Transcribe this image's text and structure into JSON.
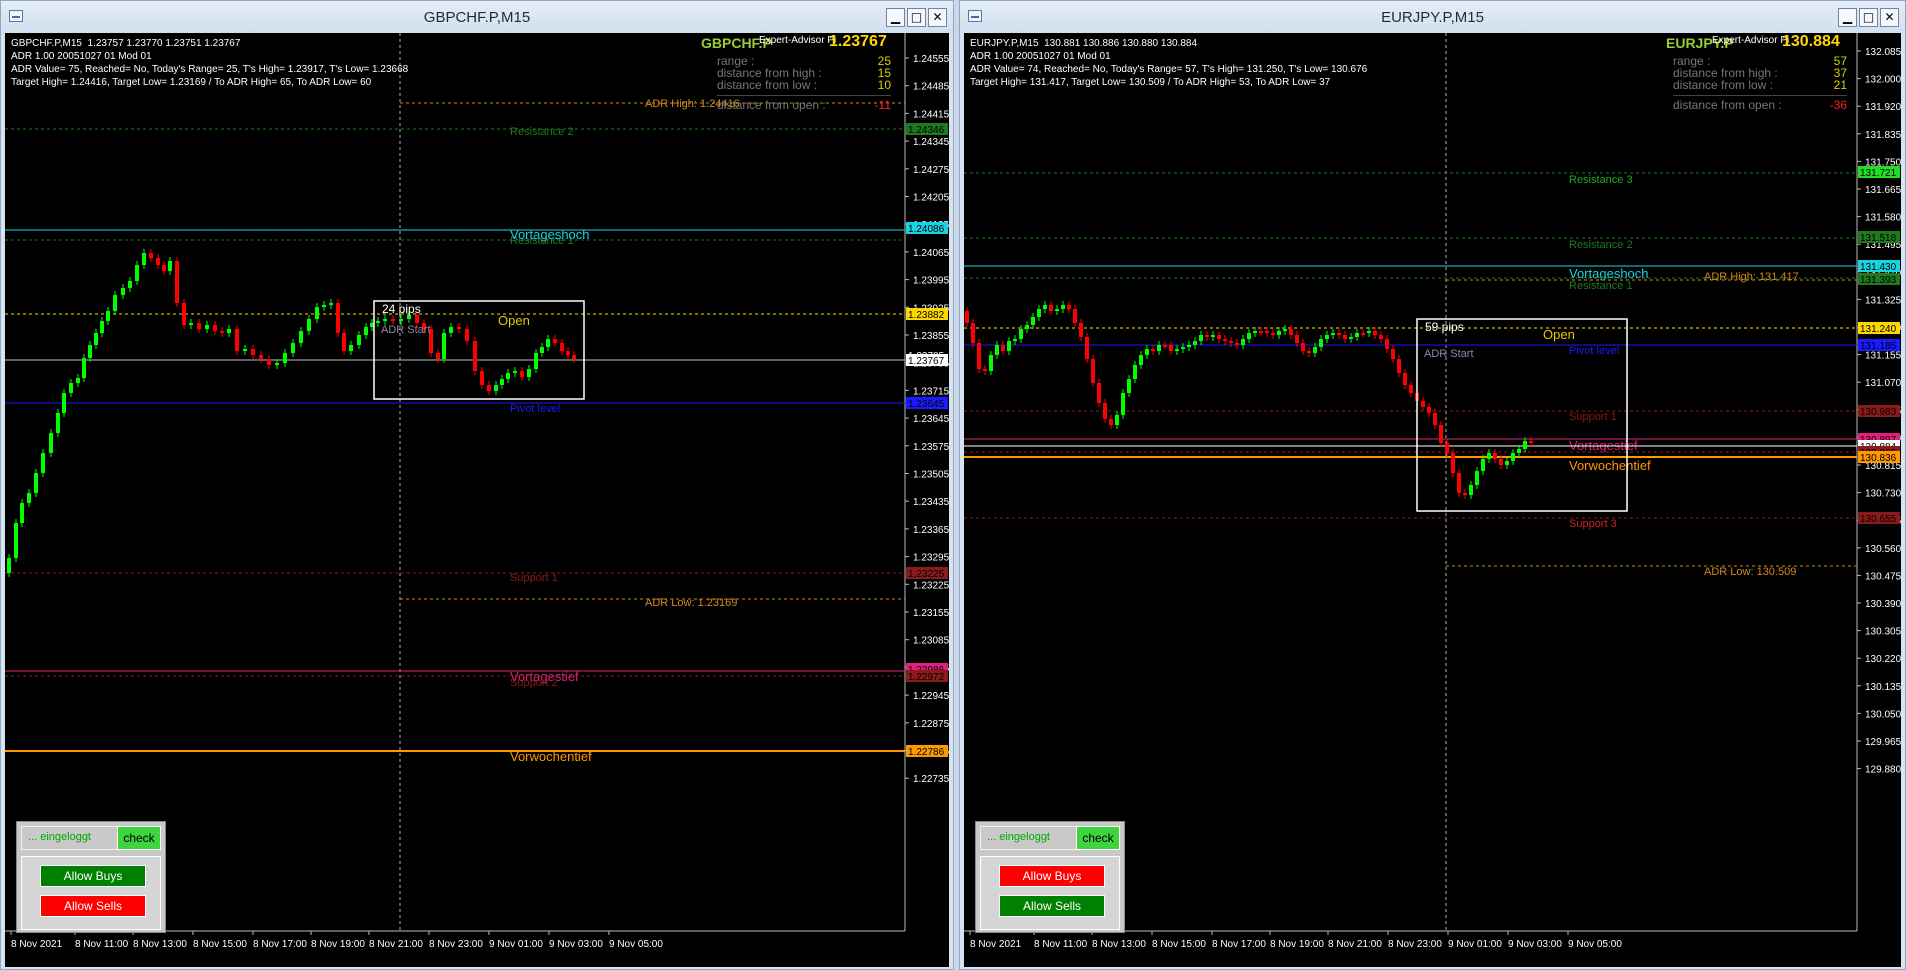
{
  "windows": [
    {
      "title": "GBPCHF.P,M15",
      "info_line1": "GBPCHF.P,M15  1.23757 1.23770 1.23751 1.23767",
      "info_line2": "ADR 1.00 20051027 01 Mod 01",
      "info_line3": "ADR Value= 75, Reached= No, Today's Range= 25, T's High= 1.23917, T's Low= 1.23668",
      "info_line4": "Target High= 1.24416, Target Low= 1.23169 / To ADR High= 65, To ADR Low= 60",
      "symbol_label": "GBPCHF.P",
      "ea_label": "Expert-Advisor Pi",
      "big_price": "1.23767",
      "stats": {
        "range_label": "range :",
        "range": "25",
        "dist_high_label": "distance from high :",
        "dist_high": "15",
        "dist_low_label": "distance from low :",
        "dist_low": "10",
        "dist_open_label": "distance from open :",
        "dist_open": "-11"
      },
      "price_ticks": [
        "1.24555",
        "1.24485",
        "1.24415",
        "1.24345",
        "1.24275",
        "1.24205",
        "1.24135",
        "1.24065",
        "1.23995",
        "1.23925",
        "1.23855",
        "1.23785",
        "1.23715",
        "1.23645",
        "1.23575",
        "1.23505",
        "1.23435",
        "1.23365",
        "1.23295",
        "1.23225",
        "1.23155",
        "1.23085",
        "1.23015",
        "1.22945",
        "1.22875",
        "1.22805",
        "1.22735"
      ],
      "price_flags": [
        "1.24346",
        "1.24086",
        "1.23882",
        "1.23785",
        "1.23767",
        "1.23645",
        "1.23225",
        "1.22986",
        "1.22972",
        "1.22786"
      ],
      "time_labels": [
        "8 Nov 2021",
        "8 Nov 11:00",
        "8 Nov 13:00",
        "8 Nov 15:00",
        "8 Nov 17:00",
        "8 Nov 19:00",
        "8 Nov 21:00",
        "8 Nov 23:00",
        "9 Nov 01:00",
        "9 Nov 03:00",
        "9 Nov 05:00"
      ],
      "levels": {
        "adr_high": "ADR High: 1.24416",
        "resistance2": "Resistance 2",
        "vortageshoch": "Vortageshoch",
        "resistance1": "Resistance 1",
        "pivot": "Pivot level",
        "support1": "Support 1",
        "adr_low": "ADR Low: 1.23169",
        "vortagestief": "Vortagestief",
        "support2": "Support 2",
        "vorwochentief": "Vorwochentief"
      },
      "box": {
        "pips": "24 pips",
        "adr_start": "ADR Start",
        "open": "Open"
      },
      "panel": {
        "status": "... eingeloggt",
        "check": "check",
        "buy": "Allow Buys",
        "sell": "Allow Sells",
        "buy_color": "#008000",
        "sell_color": "#ff0000"
      }
    },
    {
      "title": "EURJPY.P,M15",
      "info_line1": "EURJPY.P,M15  130.881 130.886 130.880 130.884",
      "info_line2": "ADR 1.00 20051027 01 Mod 01",
      "info_line3": "ADR Value= 74, Reached= No, Today's Range= 57, T's High= 131.250, T's Low= 130.676",
      "info_line4": "Target High= 131.417, Target Low= 130.509 / To ADR High= 53, To ADR Low= 37",
      "symbol_label": "EURJPY.P",
      "ea_label": "Expert-Advisor Pi",
      "big_price": "130.884",
      "stats": {
        "range_label": "range :",
        "range": "57",
        "dist_high_label": "distance from high :",
        "dist_high": "37",
        "dist_low_label": "distance from low :",
        "dist_low": "21",
        "dist_open_label": "distance from open :",
        "dist_open": "-36"
      },
      "price_ticks": [
        "132.085",
        "132.000",
        "131.920",
        "131.835",
        "131.750",
        "131.665",
        "131.580",
        "131.495",
        "131.410",
        "131.325",
        "131.240",
        "131.155",
        "131.070",
        "130.985",
        "130.900",
        "130.815",
        "130.730",
        "130.645",
        "130.560",
        "130.475",
        "130.390",
        "130.305",
        "130.220",
        "130.135",
        "130.050",
        "129.965",
        "129.880"
      ],
      "price_flags": [
        "131.721",
        "131.518",
        "131.430",
        "131.393",
        "131.240",
        "131.185",
        "130.983",
        "130.897",
        "130.884",
        "130.865",
        "130.836",
        "130.655"
      ],
      "time_labels": [
        "8 Nov 2021",
        "8 Nov 11:00",
        "8 Nov 13:00",
        "8 Nov 15:00",
        "8 Nov 17:00",
        "8 Nov 19:00",
        "8 Nov 21:00",
        "8 Nov 23:00",
        "9 Nov 01:00",
        "9 Nov 03:00",
        "9 Nov 05:00"
      ],
      "levels": {
        "resistance3": "Resistance 3",
        "resistance2": "Resistance 2",
        "vortageshoch": "Vortageshoch",
        "adr_high": "ADR High: 131.417",
        "resistance1": "Resistance 1",
        "pivot": "Pivot level",
        "support1": "Support 1",
        "vortagestief": "Vortagestief",
        "vorwochentief": "Vorwochentief",
        "support3": "Support 3",
        "adr_low": "ADR Low: 130.509"
      },
      "box": {
        "pips": "59 pips",
        "adr_start": "ADR Start",
        "open": "Open"
      },
      "panel": {
        "status": "... eingeloggt",
        "check": "check",
        "buy": "Allow Buys",
        "sell": "Allow Sells",
        "buy_color": "#ff0000",
        "sell_color": "#008000"
      }
    }
  ],
  "titlebar_buttons": {
    "minimize": "▁",
    "maximize": "□",
    "close": "✕"
  },
  "window_menu_icon": "window-menu-icon",
  "colors": {
    "background": "#000000",
    "bull": "#00ff00",
    "bear": "#ff0000",
    "grid": "#404040"
  }
}
